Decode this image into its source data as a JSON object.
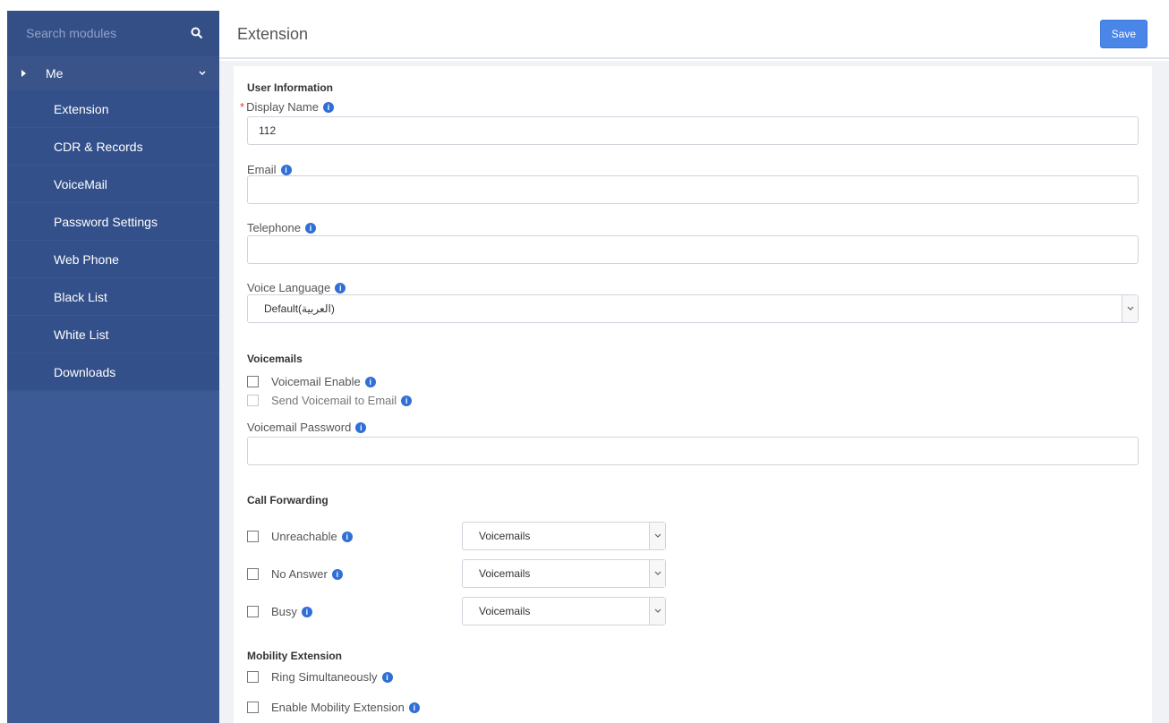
{
  "sidebar": {
    "search_placeholder": "Search modules",
    "me_label": "Me",
    "items": [
      {
        "label": "Extension"
      },
      {
        "label": "CDR & Records"
      },
      {
        "label": "VoiceMail"
      },
      {
        "label": "Password Settings"
      },
      {
        "label": "Web Phone"
      },
      {
        "label": "Black List"
      },
      {
        "label": "White List"
      },
      {
        "label": "Downloads"
      }
    ]
  },
  "header": {
    "title": "Extension",
    "save_label": "Save"
  },
  "user_information": {
    "section_title": "User Information",
    "display_name_label": "Display Name",
    "display_name_value": "112",
    "email_label": "Email",
    "email_value": "",
    "telephone_label": "Telephone",
    "telephone_value": "",
    "voice_language_label": "Voice Language",
    "voice_language_value": "Default(العربية)"
  },
  "voicemails": {
    "section_title": "Voicemails",
    "enable_label": "Voicemail Enable",
    "send_to_email_label": "Send Voicemail to Email",
    "password_label": "Voicemail Password",
    "password_value": ""
  },
  "call_forwarding": {
    "section_title": "Call Forwarding",
    "rows": [
      {
        "label": "Unreachable",
        "value": "Voicemails"
      },
      {
        "label": "No Answer",
        "value": "Voicemails"
      },
      {
        "label": "Busy",
        "value": "Voicemails"
      }
    ]
  },
  "mobility": {
    "section_title": "Mobility Extension",
    "ring_label": "Ring Simultaneously",
    "enable_label": "Enable Mobility Extension"
  },
  "info_glyph": "i",
  "required_glyph": "*",
  "colors": {
    "sidebar_bg": "#3c5a96",
    "accent": "#4a86e8",
    "info_icon": "#2f6fd6",
    "required": "#e53935"
  }
}
